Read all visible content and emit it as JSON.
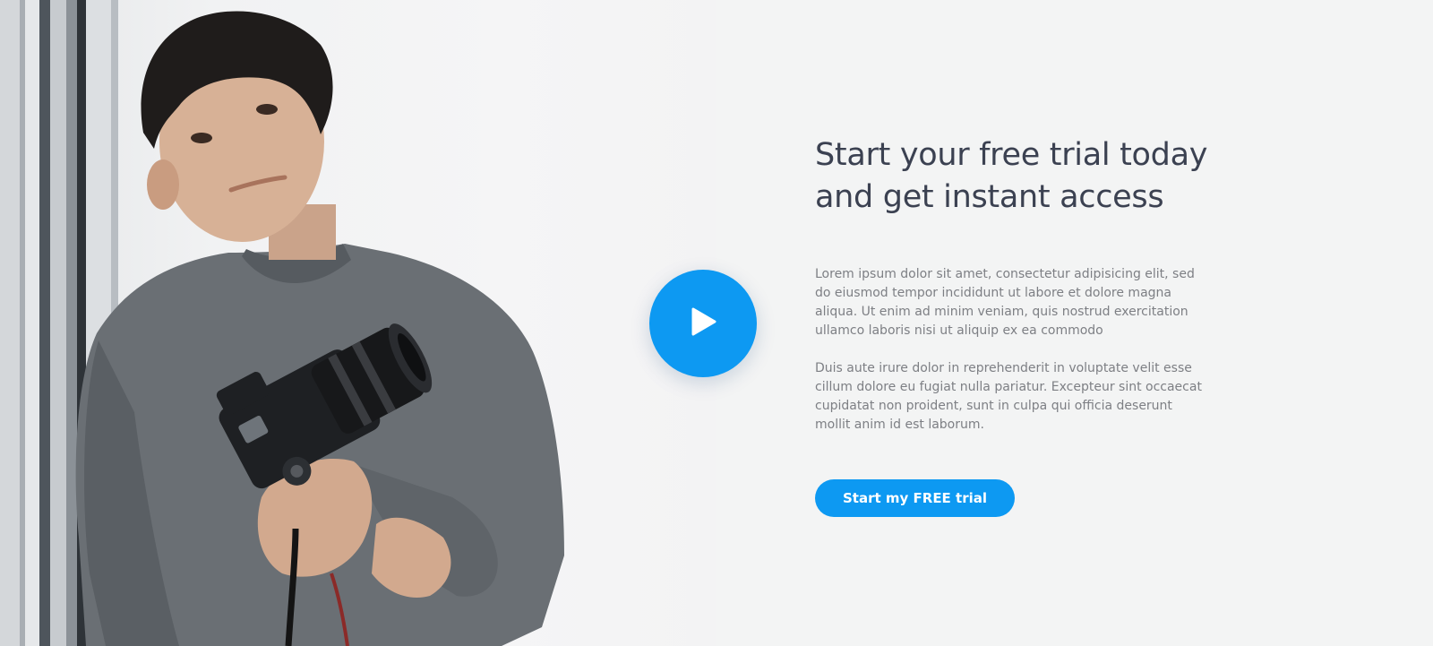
{
  "hero": {
    "headline": "Start your free trial today and get instant access",
    "paragraphs": [
      "Lorem ipsum dolor sit amet, consectetur adipisicing elit, sed do eiusmod tempor incididunt ut labore et dolore magna aliqua. Ut enim ad minim veniam, quis nostrud exercitation ullamco laboris nisi ut aliquip ex ea commodo",
      "Duis aute irure dolor in reprehenderit in voluptate velit esse cillum dolore eu fugiat nulla pariatur. Excepteur sint occaecat cupidatat non proident, sunt in culpa qui officia deserunt mollit anim id est laborum."
    ],
    "cta_label": "Start my FREE trial",
    "play_icon": "play-icon"
  },
  "colors": {
    "accent": "#0d99f2",
    "headline": "#3b4151",
    "body_text": "#7d7f84",
    "right_panel_bg": "#f3f4f4"
  }
}
